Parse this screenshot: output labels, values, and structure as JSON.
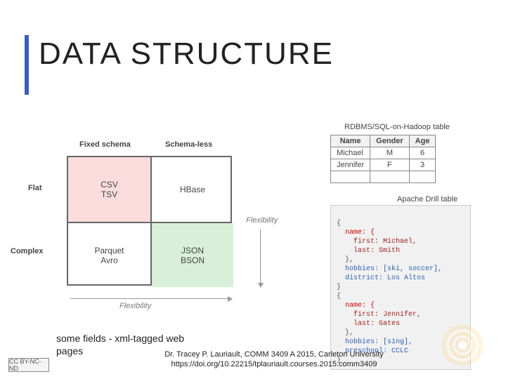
{
  "title": "DATA STRUCTURE",
  "matrix": {
    "col_fixed": "Fixed schema",
    "col_schemaless": "Schema-less",
    "row_flat": "Flat",
    "row_complex": "Complex",
    "cell_a": "CSV\nTSV",
    "cell_b": "HBase",
    "cell_c": "Parquet\nAvro",
    "cell_d": "JSON\nBSON",
    "flex_h": "Flexibility",
    "flex_v": "Flexibility"
  },
  "rdbms": {
    "label": "RDBMS/SQL-on-Hadoop table",
    "h1": "Name",
    "h2": "Gender",
    "h3": "Age",
    "r1c1": "Michael",
    "r1c2": "M",
    "r1c3": "6",
    "r2c1": "Jennifer",
    "r2c2": "F",
    "r2c3": "3"
  },
  "drill": {
    "label": "Apache Drill table",
    "open": "{",
    "l_name": "  name: {",
    "l_first1": "    first: Michael,",
    "l_last1": "    last: Smith",
    "l_closeA": "  },",
    "l_hobbies1": "  hobbies: [ski, soccer],",
    "l_district": "  district: Los Altos",
    "close1": "}",
    "open2": "{",
    "l_name2": "  name: {",
    "l_first2": "    first: Jennifer,",
    "l_last2": "    last: Gates",
    "l_closeB": "  },",
    "l_hobbies2": "  hobbies: [sing],",
    "l_preschool": "  preschool: CCLC",
    "close2": "}"
  },
  "cutoff": {
    "line1": "some fields - xml-tagged web",
    "line2": "pages"
  },
  "credit": {
    "line1": "Dr. Tracey P. Lauriault, COMM 3409 A 2015, Carleton University",
    "line2": "https://doi.org/10.22215/tplauriault.courses.2015.comm3409"
  },
  "cc": "CC BY-NC-ND"
}
